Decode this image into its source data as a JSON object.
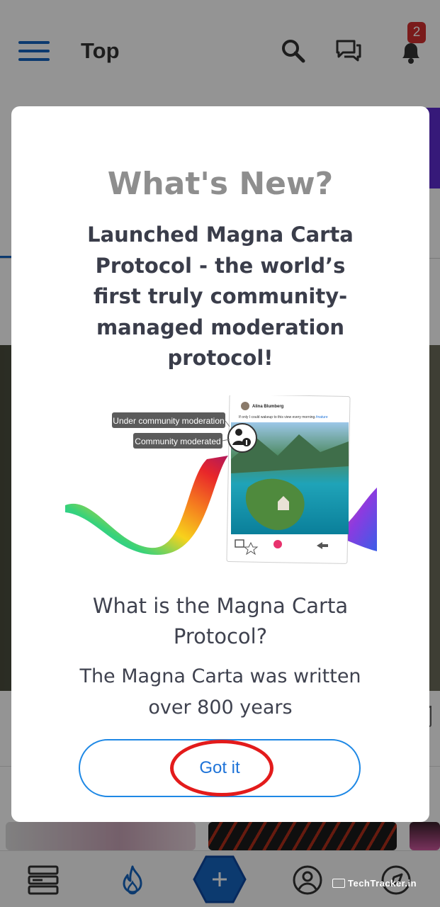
{
  "header": {
    "title": "Top",
    "notification_count": "2"
  },
  "modal": {
    "title": "What's New?",
    "headline": "Launched Magna Carta Protocol - the world’s first truly community-managed moderation protocol!",
    "illustration": {
      "tag_under_moderation": "Under community moderation",
      "tag_moderated": "Community moderated",
      "post_author": "Alina Blumberg",
      "post_caption": "If only I could wakeup to this view every morning.",
      "post_hashtag": "#nature"
    },
    "question": "What is the Magna Carta Protocol?",
    "body": "The Magna Carta was written over 800 years",
    "button_label": "Got it"
  },
  "watermark": {
    "text": "TechTracker.in"
  },
  "colors": {
    "brand_blue": "#1565c0",
    "button_blue": "#1e88e5",
    "badge_red": "#d32f2f",
    "annotation_red": "#e31b1b",
    "title_gray": "#8e8e8e",
    "headline_dark": "#3a3d4a"
  }
}
